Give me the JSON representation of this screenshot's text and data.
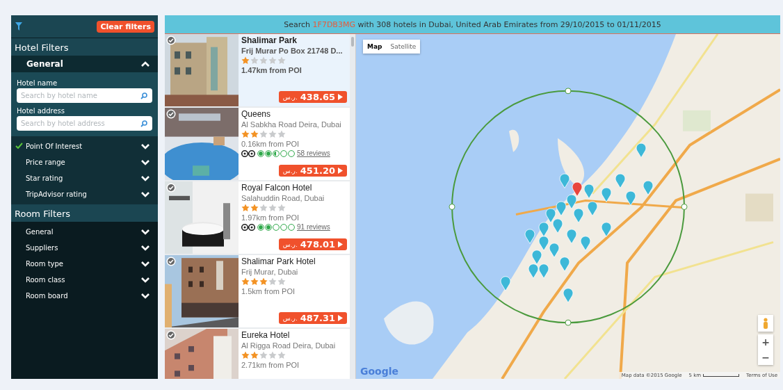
{
  "sidebar": {
    "clear_button": "Clear filters",
    "hotel_filters": {
      "title": "Hotel Filters",
      "general": {
        "label": "General",
        "expanded": true,
        "fields": [
          {
            "label": "Hotel name",
            "placeholder": "Search by hotel name"
          },
          {
            "label": "Hotel address",
            "placeholder": "Search by hotel address"
          }
        ]
      },
      "items": [
        {
          "label": "Point Of Interest",
          "checked": true
        },
        {
          "label": "Price range",
          "checked": false
        },
        {
          "label": "Star rating",
          "checked": false
        },
        {
          "label": "TripAdvisor rating",
          "checked": false
        }
      ]
    },
    "room_filters": {
      "title": "Room Filters",
      "items": [
        {
          "label": "General",
          "checked": false
        },
        {
          "label": "Suppliers",
          "checked": false
        },
        {
          "label": "Room type",
          "checked": false
        },
        {
          "label": "Room class",
          "checked": false
        },
        {
          "label": "Room board",
          "checked": false
        }
      ]
    }
  },
  "header": {
    "prefix": "Search ",
    "code": "1F7DB3MG",
    "suffix": " with 308 hotels in Dubai, United Arab Emirates from 29/10/2015 to 01/11/2015"
  },
  "hotels": [
    {
      "name": "Shalimar Park",
      "address": "Frij Murar Po Box 21748 D...",
      "stars": 1,
      "distance": "1.47km from POI",
      "selected": true,
      "currency": "ر.س.",
      "amount": "438.65"
    },
    {
      "name": "Queens",
      "address": "Al Sabkha Road Deira, Dubai",
      "stars": 2,
      "distance": "0.16km from POI",
      "selected": false,
      "tripadvisor": {
        "stars": 2.5,
        "reviews": "58 reviews"
      },
      "currency": "ر.س.",
      "amount": "451.20"
    },
    {
      "name": "Royal Falcon Hotel",
      "address": "Salahuddin Road, Dubai",
      "stars": 2,
      "distance": "1.97km from POI",
      "selected": false,
      "tripadvisor": {
        "stars": 2,
        "reviews": "91 reviews"
      },
      "currency": "ر.س.",
      "amount": "478.01"
    },
    {
      "name": "Shalimar Park Hotel",
      "address": "Frij Murar, Dubai",
      "stars": 3,
      "distance": "1.5km from POI",
      "selected": false,
      "currency": "ر.س.",
      "amount": "487.31"
    },
    {
      "name": "Eureka Hotel",
      "address": "Al Rigga Road Deira, Dubai",
      "stars": 2,
      "distance": "2.71km from POI",
      "selected": false
    }
  ],
  "map": {
    "types": [
      {
        "label": "Map",
        "selected": true
      },
      {
        "label": "Satellite",
        "selected": false
      }
    ],
    "zoom_in": "+",
    "zoom_out": "−",
    "logo": "Google",
    "attribution": "Map data ©2015 Google",
    "scale": "5 km",
    "terms": "Terms of Use"
  }
}
